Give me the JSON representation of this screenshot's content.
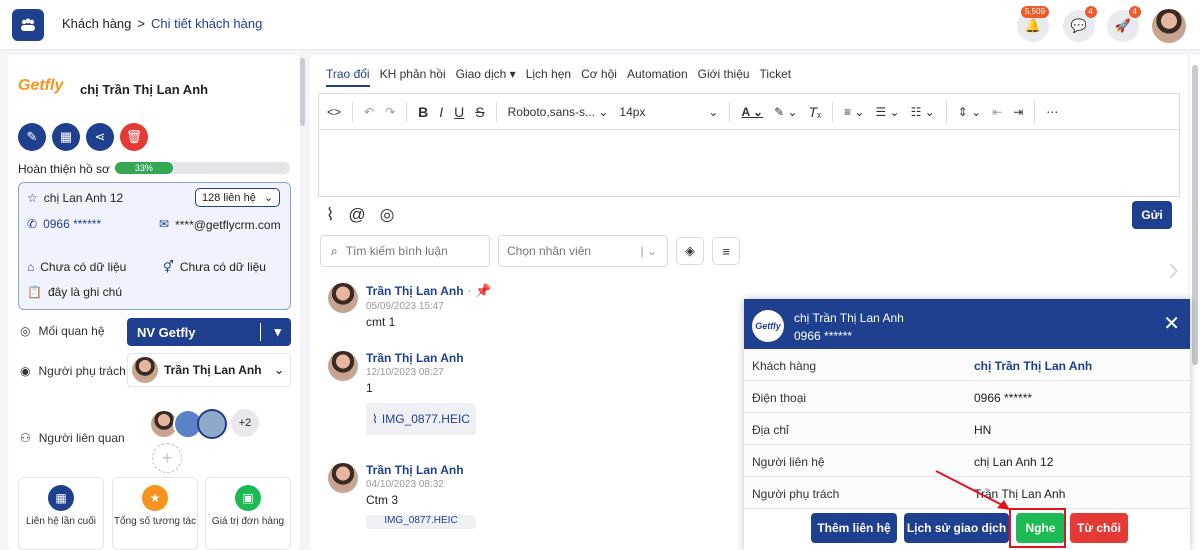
{
  "breadcrumb": {
    "home": "Khách hàng",
    "separator": ">",
    "current": "Chi tiết khách hàng"
  },
  "topbar": {
    "notif_count": "5,509",
    "chat_count": "4",
    "rocket_count": "4"
  },
  "profile": {
    "logo_text": "Getfly",
    "name": "chị Trần Thị Lan Anh",
    "progress_label": "Hoàn thiện hồ sơ",
    "progress_value": "33%",
    "progress_fraction": 0.33
  },
  "info": {
    "contact_name": "chị Lan Anh 12",
    "contact_count": "128 liên hệ",
    "phone": "0966 ******",
    "email": "****@getflycrm.com",
    "org": "Chưa có dữ liệu",
    "gender": "Chưa có dữ liệu",
    "note": "đây là ghi chú"
  },
  "fields": {
    "relation_label": "Mối quan hệ",
    "relation_value": "NV Getfly",
    "owner_label": "Người phụ trách",
    "owner_value": "Trần Thị Lan Anh",
    "related_label": "Người liên quan",
    "related_more": "+2"
  },
  "cards": [
    {
      "label": "Liên hệ lần cuối"
    },
    {
      "label": "Tổng số tương tác"
    },
    {
      "label": "Giá trị đơn hàng"
    }
  ],
  "tabs": [
    "Trao đổi",
    "KH phản hồi",
    "Giao dịch ▾",
    "Lịch hẹn",
    "Cơ hội",
    "Automation",
    "Giới thiệu",
    "Ticket"
  ],
  "editor": {
    "font": "Roboto,sans-s...",
    "size": "14px",
    "send": "Gửi"
  },
  "filters": {
    "search_placeholder": "Tìm kiếm bình luận",
    "staff_placeholder": "Chọn nhân viên"
  },
  "comments": [
    {
      "name": "Trần Thị Lan Anh",
      "time": "05/09/2023 15:47",
      "text": "cmt 1",
      "attachment": ""
    },
    {
      "name": "Trần Thị Lan Anh",
      "time": "12/10/2023 08:27",
      "text": "1",
      "attachment": "IMG_0877.HEIC"
    },
    {
      "name": "Trần Thị Lan Anh",
      "time": "04/10/2023 08:32",
      "text": "Ctm 3",
      "attachment": "IMG_0877.HEIC"
    }
  ],
  "popup": {
    "logo": "Getfly",
    "name": "chị Trần Thị Lan Anh",
    "phone": "0966 ******",
    "rows": [
      {
        "label": "Khách hàng",
        "value": "chị Trần Thị Lan Anh"
      },
      {
        "label": "Điện thoại",
        "value": "0966 ******"
      },
      {
        "label": "Địa chỉ",
        "value": "HN"
      },
      {
        "label": "Người liên hệ",
        "value": "chị Lan Anh 12"
      },
      {
        "label": "Người phụ trách",
        "value": "Trần Thị Lan Anh"
      }
    ],
    "btn_add": "Thêm liên hệ",
    "btn_history": "Lịch sử giao dịch",
    "btn_answer": "Nghe",
    "btn_reject": "Từ chối"
  },
  "colors": {
    "primary": "#1f3f8f",
    "success": "#1db954",
    "danger": "#e53935",
    "accent": "#f05a28"
  }
}
